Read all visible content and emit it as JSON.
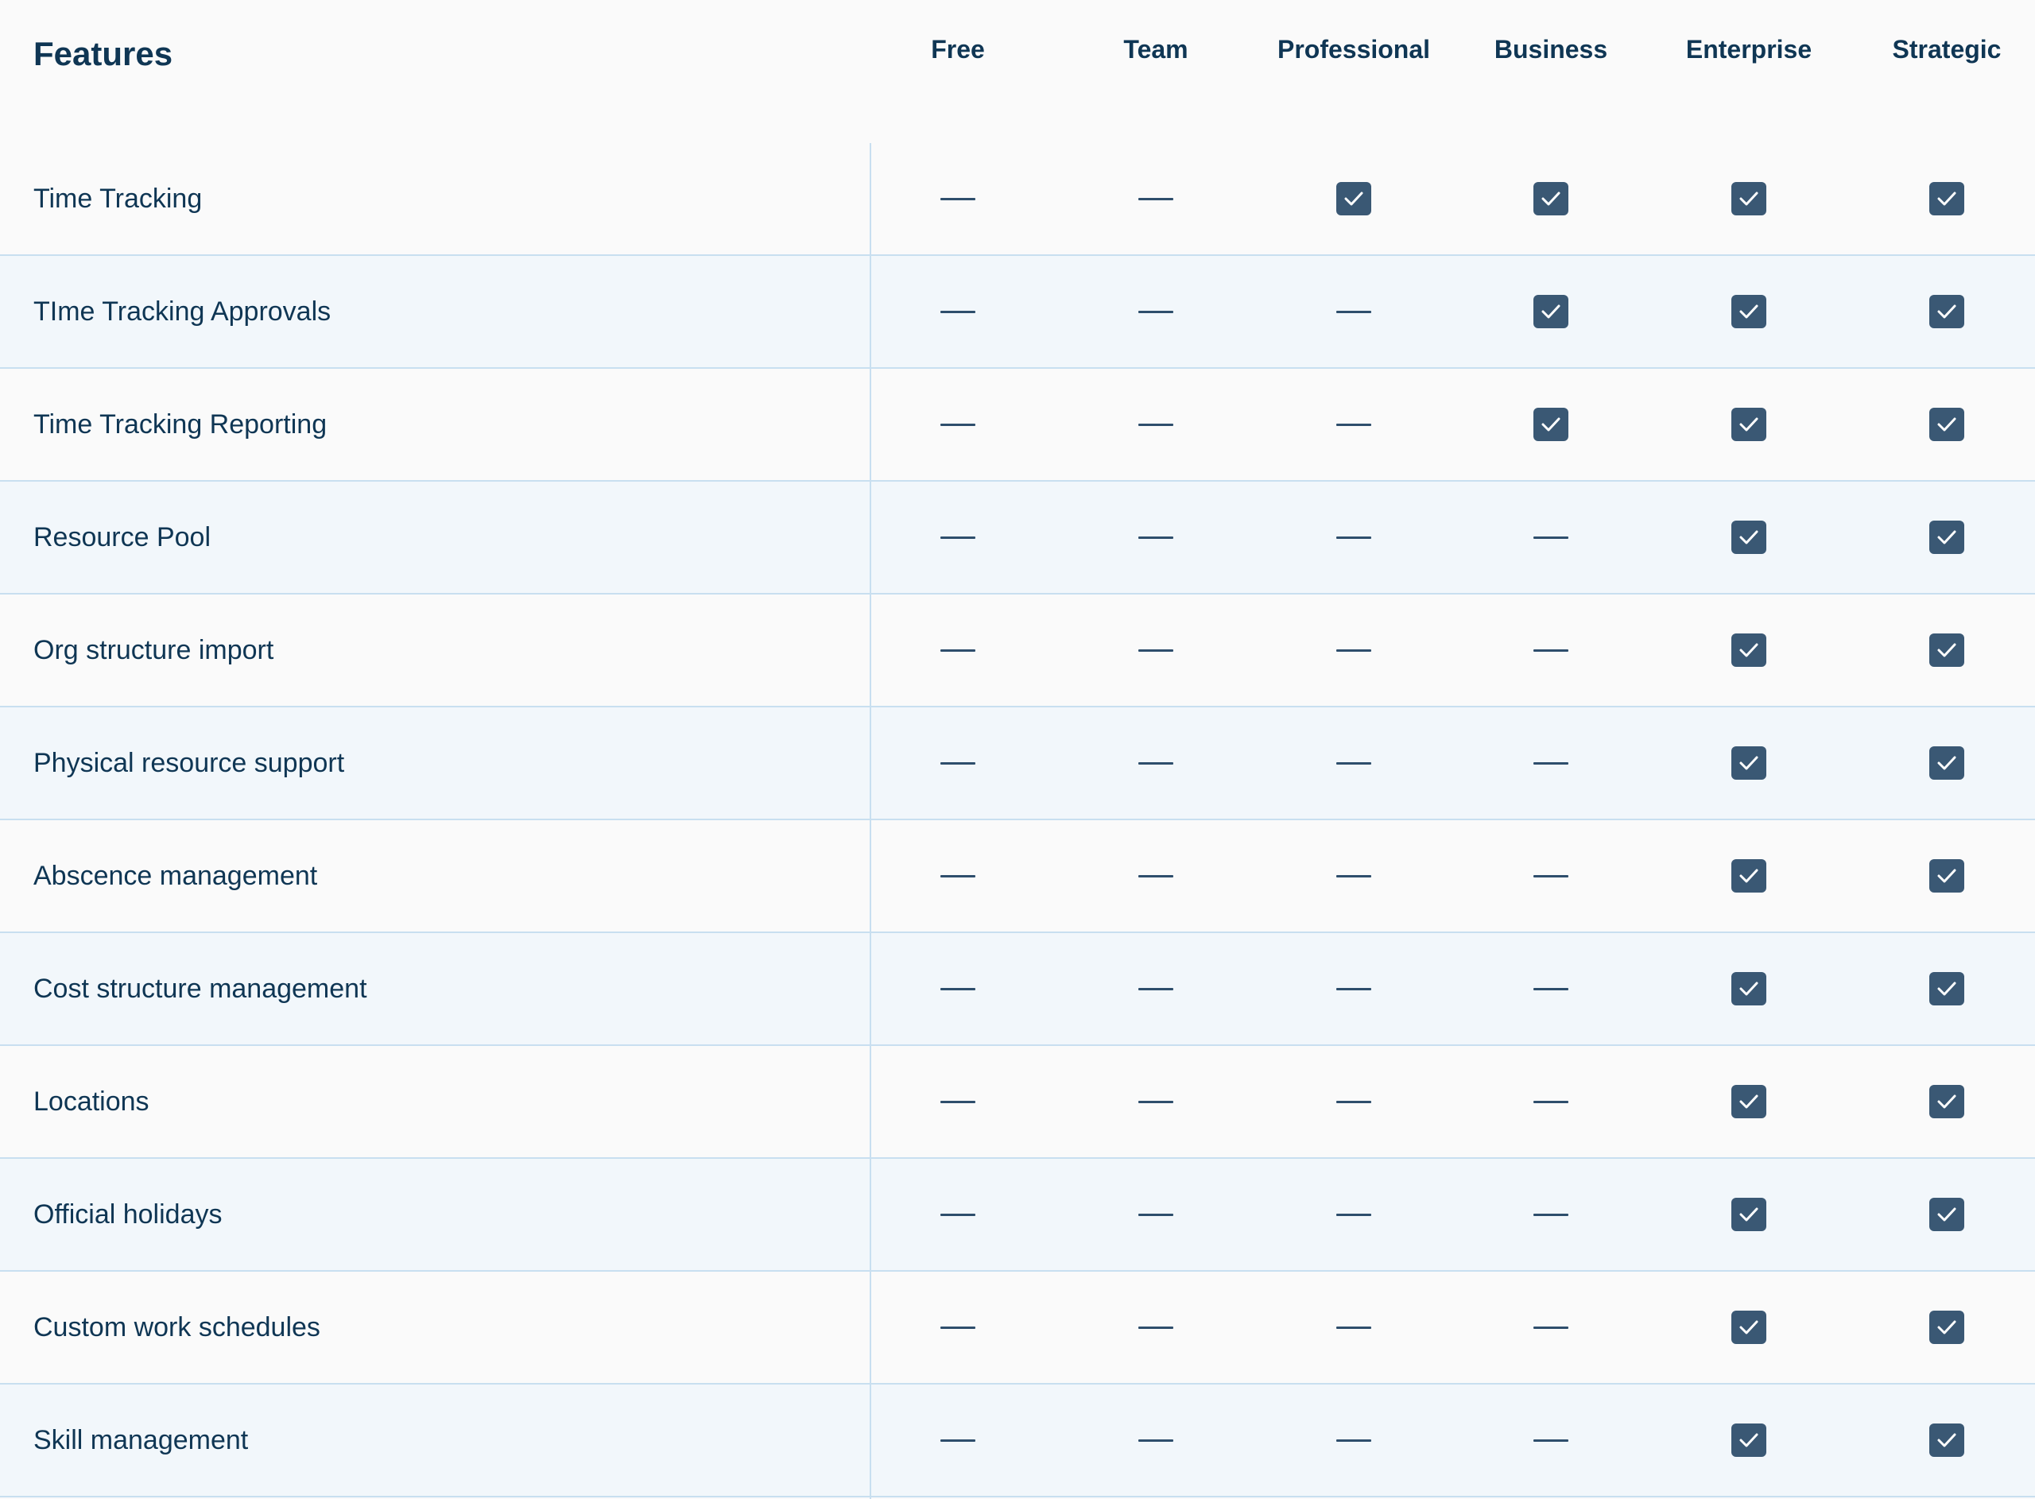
{
  "header": {
    "title": "Features",
    "plans": [
      "Free",
      "Team",
      "Professional",
      "Business",
      "Enterprise",
      "Strategic"
    ]
  },
  "features": [
    {
      "label": "Time Tracking",
      "availability": [
        false,
        false,
        true,
        true,
        true,
        true
      ]
    },
    {
      "label": "TIme Tracking Approvals",
      "availability": [
        false,
        false,
        false,
        true,
        true,
        true
      ]
    },
    {
      "label": "Time Tracking Reporting",
      "availability": [
        false,
        false,
        false,
        true,
        true,
        true
      ]
    },
    {
      "label": "Resource Pool",
      "availability": [
        false,
        false,
        false,
        false,
        true,
        true
      ]
    },
    {
      "label": "Org structure import",
      "availability": [
        false,
        false,
        false,
        false,
        true,
        true
      ]
    },
    {
      "label": "Physical resource support",
      "availability": [
        false,
        false,
        false,
        false,
        true,
        true
      ]
    },
    {
      "label": "Abscence management",
      "availability": [
        false,
        false,
        false,
        false,
        true,
        true
      ]
    },
    {
      "label": "Cost structure management",
      "availability": [
        false,
        false,
        false,
        false,
        true,
        true
      ]
    },
    {
      "label": "Locations",
      "availability": [
        false,
        false,
        false,
        false,
        true,
        true
      ]
    },
    {
      "label": "Official holidays",
      "availability": [
        false,
        false,
        false,
        false,
        true,
        true
      ]
    },
    {
      "label": "Custom work schedules",
      "availability": [
        false,
        false,
        false,
        false,
        true,
        true
      ]
    },
    {
      "label": "Skill management",
      "availability": [
        false,
        false,
        false,
        false,
        true,
        true
      ]
    }
  ],
  "icons": {
    "included": "check-icon",
    "not_included": "dash-icon"
  },
  "colors": {
    "text": "#0f3654",
    "check_fill": "#3a5874",
    "divider": "#c8dff0",
    "row_alt": "#f2f7fb",
    "background": "#fafafa"
  }
}
